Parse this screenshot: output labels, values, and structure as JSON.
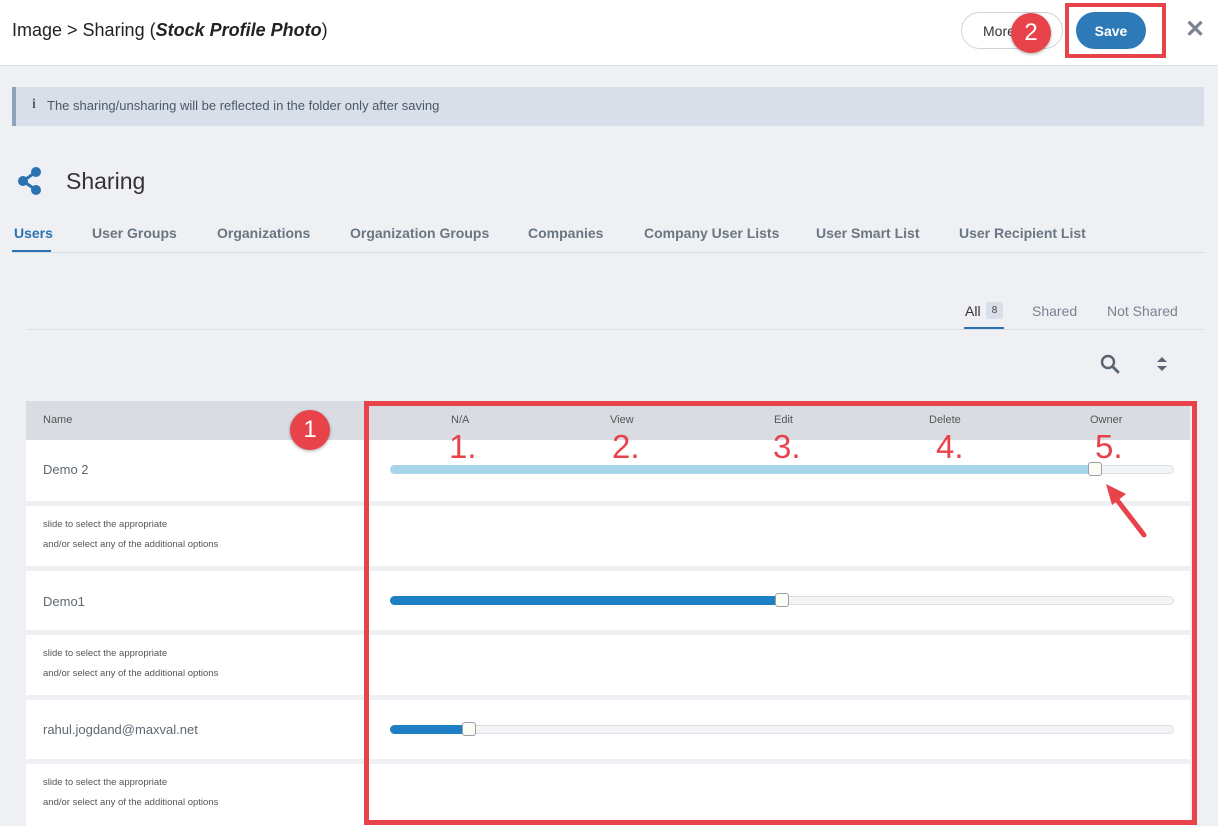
{
  "header": {
    "crumb_prefix": "Image > Sharing (",
    "crumb_item": "Stock Profile Photo",
    "crumb_suffix": ")",
    "more_label": "More",
    "save_label": "Save",
    "close_glyph": "✕"
  },
  "annotations": {
    "badge_table": "1",
    "badge_save": "2",
    "level_numbers": [
      "1.",
      "2.",
      "3.",
      "4.",
      "5."
    ],
    "color": "#e8424a"
  },
  "banner": {
    "icon": "info-icon",
    "text": "The sharing/unsharing will be reflected in the folder only after saving"
  },
  "section": {
    "icon": "share-icon",
    "title": "Sharing"
  },
  "tabs": [
    {
      "label": "Users",
      "active": true
    },
    {
      "label": "User Groups"
    },
    {
      "label": "Organizations"
    },
    {
      "label": "Organization Groups"
    },
    {
      "label": "Companies"
    },
    {
      "label": "Company User Lists"
    },
    {
      "label": "User Smart List"
    },
    {
      "label": "User Recipient List"
    }
  ],
  "filters": {
    "all_label": "All",
    "all_count": "8",
    "shared_label": "Shared",
    "not_shared_label": "Not Shared"
  },
  "table": {
    "name_header": "Name",
    "levels": [
      "N/A",
      "View",
      "Edit",
      "Delete",
      "Owner"
    ],
    "hint_line1": "slide to select the appropriate",
    "hint_line2": "and/or select any of the additional options",
    "rows": [
      {
        "name": "Demo 2",
        "level_fraction": 0.9,
        "fill_color": "#a9d5ea"
      },
      {
        "name": "Demo1",
        "level_fraction": 0.5,
        "fill_color": "#1e7fc2"
      },
      {
        "name": "rahul.jogdand@maxval.net",
        "level_fraction": 0.1,
        "fill_color": "#1e7fc2"
      }
    ]
  },
  "colors": {
    "accent": "#2a72b0",
    "save_button": "#2e7ab8"
  }
}
